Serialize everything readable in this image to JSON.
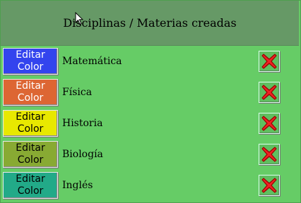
{
  "header": {
    "title": "Disciplinas / Materias creadas"
  },
  "edit_button": {
    "line1": "Editar",
    "line2": "Color"
  },
  "subjects": [
    {
      "name": "Matemática",
      "color": "#3344ee",
      "text_color": "#ffffff"
    },
    {
      "name": "Física",
      "color": "#dd6633",
      "text_color": "#ffffff"
    },
    {
      "name": "Historia",
      "color": "#e8e800",
      "text_color": "#000000"
    },
    {
      "name": "Biología",
      "color": "#88aa33",
      "text_color": "#000000"
    },
    {
      "name": "Inglés",
      "color": "#22aa88",
      "text_color": "#000000"
    }
  ],
  "icons": {
    "delete": "close-x-icon",
    "cursor": "mouse-pointer-icon"
  }
}
